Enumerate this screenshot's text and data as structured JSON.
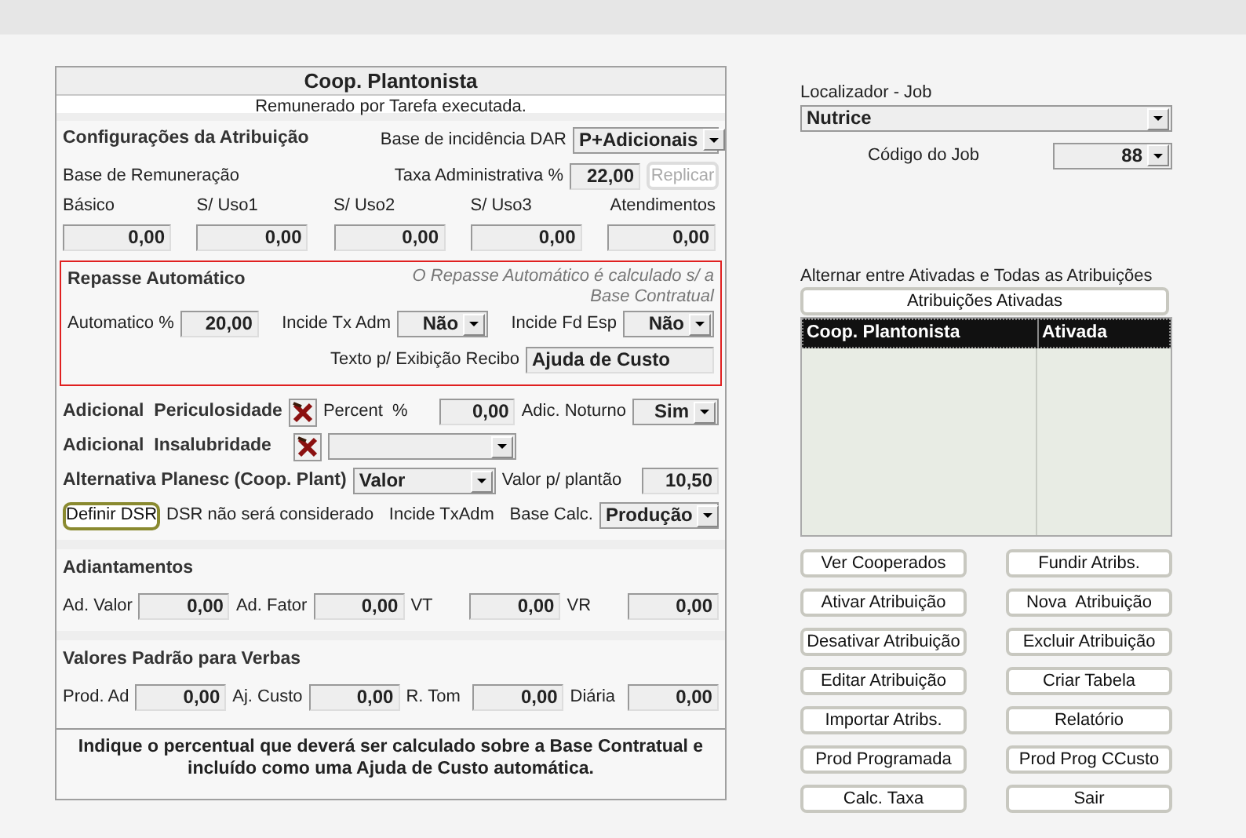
{
  "header": {
    "title": "Coop. Plantonista",
    "subtitle": "Remunerado por Tarefa executada."
  },
  "config": {
    "heading": "Configurações da Atribuição",
    "dar_label": "Base de incidência DAR",
    "dar_value": "P+Adicionais",
    "base_label": "Base de Remuneração",
    "taxa_label": "Taxa Administrativa %",
    "taxa_value": "22,00",
    "replicar": {
      "label": "Replicar",
      "disabled": true
    },
    "fields": [
      {
        "label": "Básico",
        "value": "0,00"
      },
      {
        "label": "S/ Uso1",
        "value": "0,00"
      },
      {
        "label": "S/ Uso2",
        "value": "0,00"
      },
      {
        "label": "S/ Uso3",
        "value": "0,00"
      },
      {
        "label": "Atendimentos",
        "value": "0,00"
      }
    ]
  },
  "repasse": {
    "heading": "Repasse Automático",
    "note": "O Repasse Automático é calculado s/ a Base Contratual",
    "highlighted": true,
    "automatico_label": "Automatico %",
    "automatico_value": "20,00",
    "incide_tx_label": "Incide Tx Adm",
    "incide_tx_value": "Não",
    "incide_fd_label": "Incide Fd Esp",
    "incide_fd_value": "Não",
    "texto_label": "Texto p/ Exibição Recibo",
    "texto_value": "Ajuda de Custo"
  },
  "periculosidade": {
    "label": "Adicional  Periculosidade",
    "percent_label": "Percent  %",
    "percent_value": "0,00",
    "noturno_label": "Adic. Noturno",
    "noturno_value": "Sim"
  },
  "insalubridade": {
    "label": "Adicional  Insalubridade"
  },
  "alternativa": {
    "label": "Alternativa Planesc (Coop. Plant)",
    "select_value": "Valor",
    "plantao_label": "Valor p/ plantão",
    "plantao_value": "10,50"
  },
  "dsr": {
    "button": "Definir DSR",
    "status": "DSR não será considerado",
    "incide_label": "Incide TxAdm",
    "base_label": "Base Calc.",
    "base_value": "Produção"
  },
  "adiantamentos": {
    "heading": "Adiantamentos",
    "fields": [
      {
        "label": "Ad. Valor",
        "value": "0,00"
      },
      {
        "label": "Ad. Fator",
        "value": "0,00"
      },
      {
        "label": "VT",
        "value": "0,00"
      },
      {
        "label": "VR",
        "value": "0,00"
      }
    ]
  },
  "verbas": {
    "heading": "Valores Padrão para Verbas",
    "fields": [
      {
        "label": "Prod. Ad",
        "value": "0,00"
      },
      {
        "label": "Aj. Custo",
        "value": "0,00"
      },
      {
        "label": "R. Tom",
        "value": "0,00"
      },
      {
        "label": "Diária",
        "value": "0,00"
      }
    ]
  },
  "hint": "Indique o percentual que deverá ser calculado sobre a Base Contratual e incluído como uma Ajuda de Custo automática.",
  "localizador": {
    "label": "Localizador - Job",
    "value": "Nutrice",
    "codigo_label": "Código do Job",
    "codigo_value": "88"
  },
  "alternar": {
    "label": "Alternar entre Ativadas e Todas as Atribuições",
    "toggle": "Atribuições Ativadas"
  },
  "table": {
    "columns": [
      "Coop. Plantonista",
      "Ativada"
    ]
  },
  "buttons": [
    "Ver Cooperados",
    "Fundir Atribs.",
    "Ativar Atribuição",
    "Nova  Atribuição",
    "Desativar Atribuição",
    "Excluir Atribuição",
    "Editar Atribuição",
    "Criar Tabela",
    "Importar Atribs.",
    "Relatório",
    "Prod Programada",
    "Prod Prog CCusto",
    "Calc. Taxa",
    "Sair"
  ]
}
